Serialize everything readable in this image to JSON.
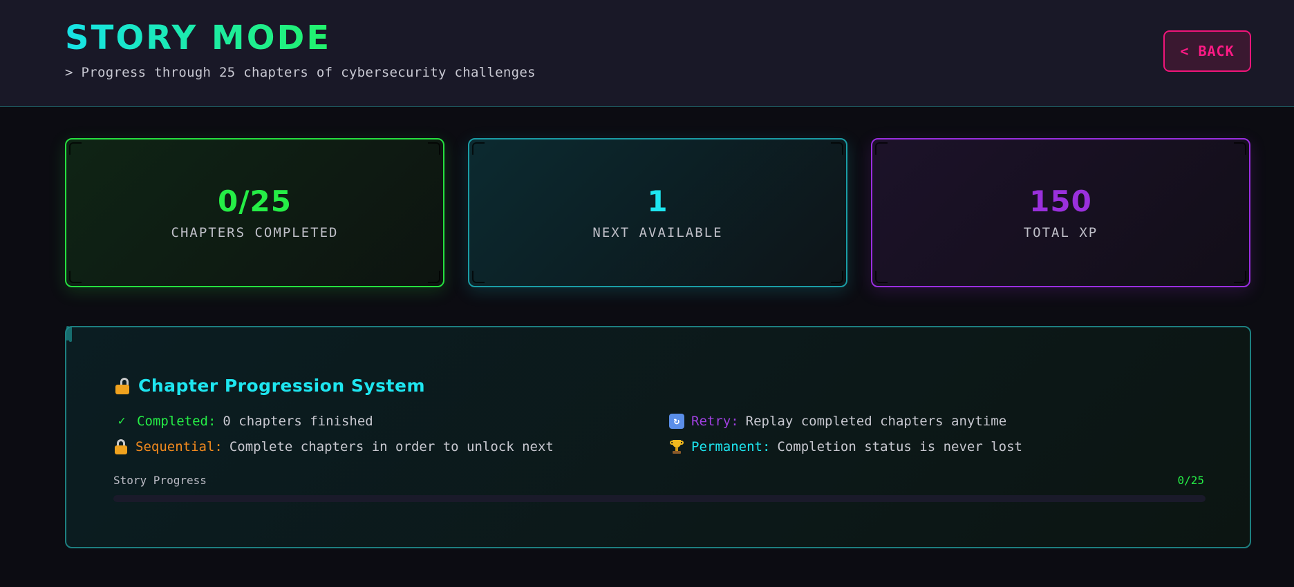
{
  "header": {
    "title": "STORY MODE",
    "subtitle": "> Progress through 25 chapters of cybersecurity challenges",
    "back_label": "< BACK"
  },
  "stats": [
    {
      "value": "0/25",
      "label": "CHAPTERS COMPLETED",
      "color": "#25ee46"
    },
    {
      "value": "1",
      "label": "NEXT AVAILABLE",
      "color": "#1ee6f0"
    },
    {
      "value": "150",
      "label": "TOTAL XP",
      "color": "#9a30dc"
    }
  ],
  "panel": {
    "title": "Chapter Progression System",
    "title_icon": "lock-open-icon",
    "features": [
      {
        "icon": "checkmark-icon",
        "icon_glyph": "✓",
        "key": "Completed:",
        "text": "0 chapters finished",
        "color": "#25ee46"
      },
      {
        "icon": "retry-icon",
        "icon_glyph": "↻",
        "key": "Retry:",
        "text": "Replay completed chapters anytime",
        "color": "#a040e0"
      },
      {
        "icon": "lock-icon",
        "key": "Sequential:",
        "text": "Complete chapters in order to unlock next",
        "color": "#f28a1e"
      },
      {
        "icon": "trophy-icon",
        "key": "Permanent:",
        "text": "Completion status is never lost",
        "color": "#1ee6f0"
      }
    ],
    "progress": {
      "label": "Story Progress",
      "count": "0/25",
      "fraction": 0
    }
  }
}
